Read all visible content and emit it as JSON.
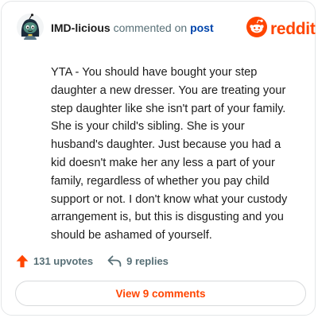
{
  "comment": {
    "author": "IMD-licious",
    "action_text": "commented on",
    "post_link_text": "post",
    "body": "YTA - You should have bought your step daughter a new dresser. You are treating your step daughter like she isn't part of your family. She is your child's sibling. She is your husband's daughter. Just because you had a kid doesn't make her any less a part of your family, regardless of whether you pay child support or not. I don't know what your custody arrangement is, but this is disgusting and you should be ashamed of yourself.",
    "upvotes": "131 upvotes",
    "replies": "9 replies"
  },
  "brand": {
    "wordmark": "reddit",
    "color": "#ff4500"
  },
  "view_comments_label": "View 9 comments",
  "icons": {
    "avatar": "avatar-icon",
    "logo": "reddit-logo-icon",
    "upvote": "upvote-arrow-icon",
    "reply": "reply-arrow-icon"
  },
  "colors": {
    "accent": "#ff4500",
    "link": "#0045ac",
    "muted": "#576f76"
  }
}
